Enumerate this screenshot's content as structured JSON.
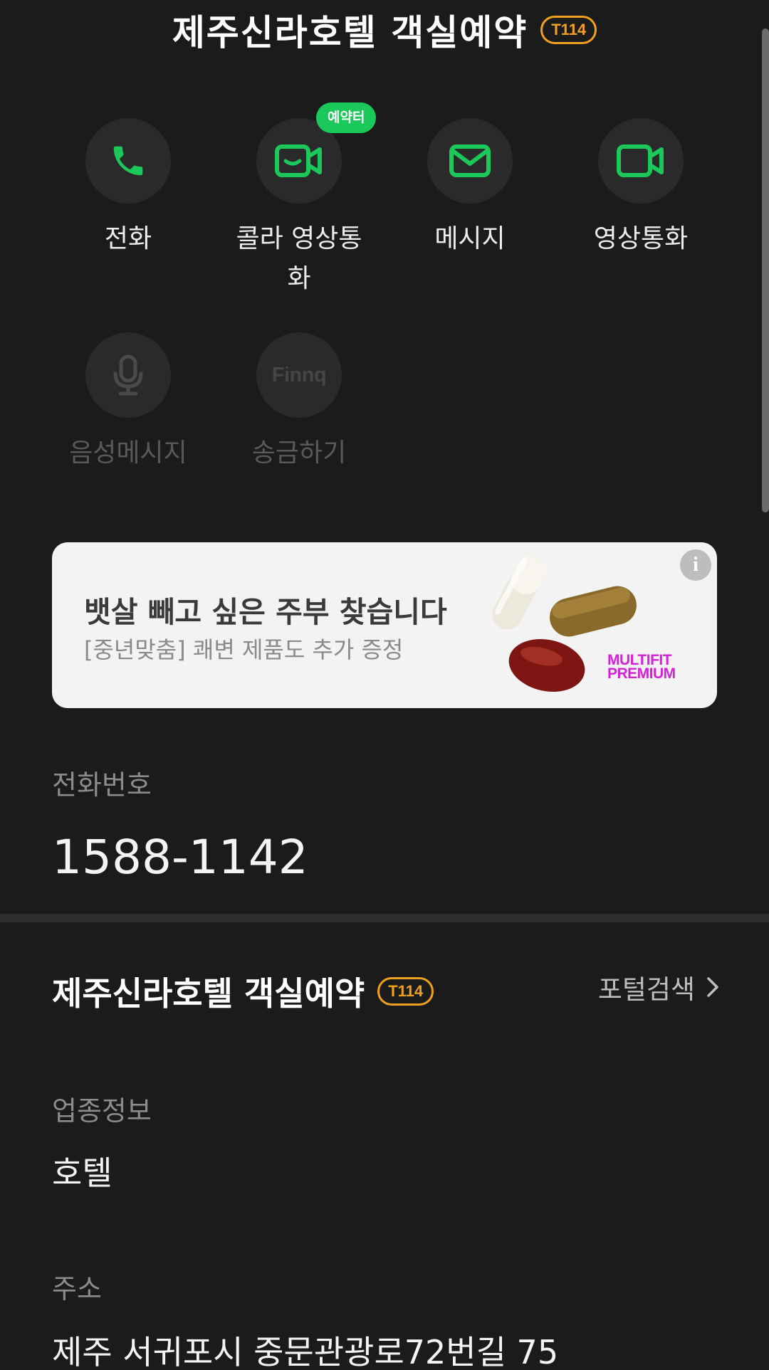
{
  "header": {
    "title": "제주신라호텔 객실예약",
    "tag": "T114"
  },
  "actions": [
    {
      "label": "전화",
      "icon": "phone-icon",
      "enabled": true
    },
    {
      "label": "콜라 영상통화",
      "icon": "video-chat-icon",
      "badge": "예약터",
      "enabled": true
    },
    {
      "label": "메시지",
      "icon": "mail-icon",
      "enabled": true
    },
    {
      "label": "영상통화",
      "icon": "video-camera-icon",
      "enabled": true
    },
    {
      "label": "음성메시지",
      "icon": "microphone-icon",
      "enabled": false
    },
    {
      "label": "송금하기",
      "icon": "finnq-logo",
      "logo_text": "Finnq",
      "enabled": false
    }
  ],
  "ad": {
    "title": "뱃살 빼고 싶은 주부 찾습니다",
    "subtitle": "[중년맞춤] 쾌변 제품도 추가 증정",
    "brand_line1": "MULTIFIT",
    "brand_line2": "PREMIUM",
    "info_symbol": "i",
    "brand_color": "#d622d6"
  },
  "phone": {
    "label": "전화번호",
    "value": "1588-1142"
  },
  "place": {
    "name": "제주신라호텔 객실예약",
    "tag": "T114",
    "portal_link": "포털검색"
  },
  "category": {
    "label": "업종정보",
    "value": "호텔"
  },
  "address": {
    "label": "주소",
    "value": "제주 서귀포시 중문관광로72번길 75"
  },
  "colors": {
    "accent_green": "#1bc85a",
    "tag_orange": "#f0a020",
    "background": "#1b1b1b"
  }
}
